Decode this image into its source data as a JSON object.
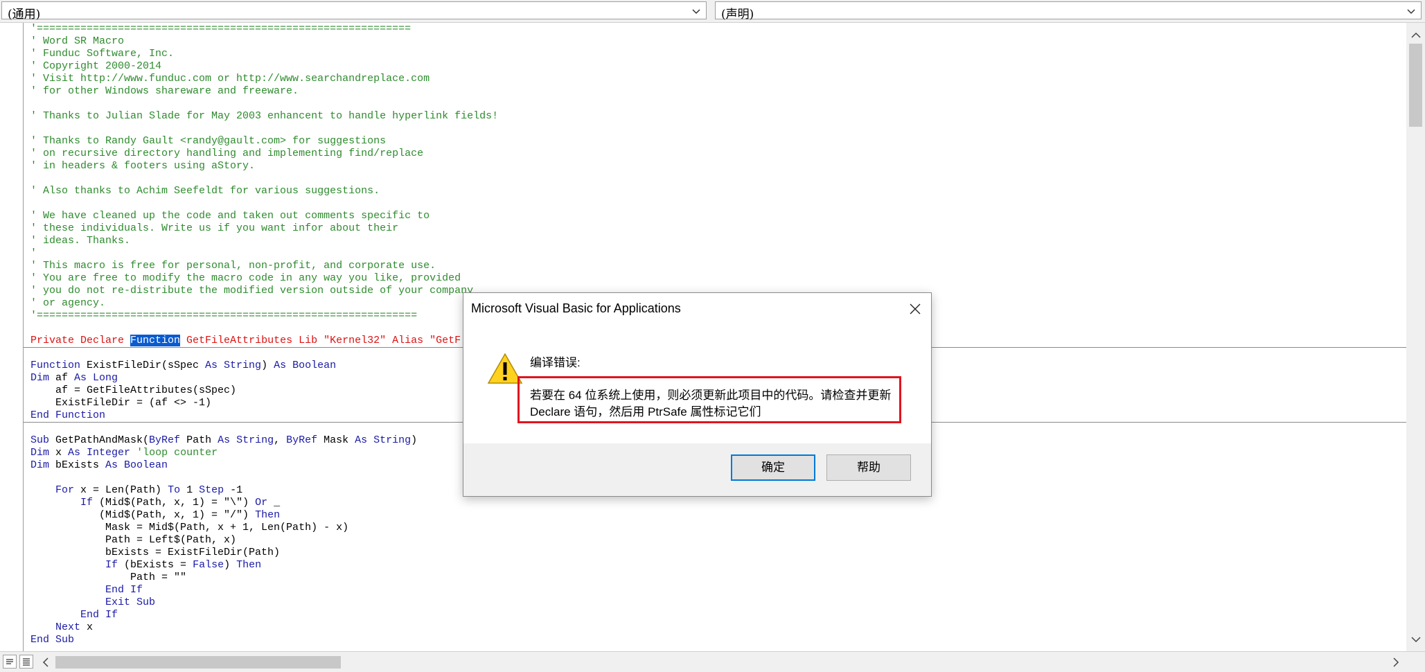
{
  "toolbar": {
    "object_combo": "(通用)",
    "procedure_combo": "(声明)"
  },
  "code_lines": [
    {
      "parts": [
        [
          "c",
          "'============================================================"
        ]
      ]
    },
    {
      "parts": [
        [
          "c",
          "' Word SR Macro"
        ]
      ]
    },
    {
      "parts": [
        [
          "c",
          "' Funduc Software, Inc."
        ]
      ]
    },
    {
      "parts": [
        [
          "c",
          "' Copyright 2000-2014"
        ]
      ]
    },
    {
      "parts": [
        [
          "c",
          "' Visit http://www.funduc.com or http://www.searchandreplace.com"
        ]
      ]
    },
    {
      "parts": [
        [
          "c",
          "' for other Windows shareware and freeware."
        ]
      ]
    },
    {
      "parts": []
    },
    {
      "parts": [
        [
          "c",
          "' Thanks to Julian Slade for May 2003 enhancent to handle hyperlink fields!"
        ]
      ]
    },
    {
      "parts": []
    },
    {
      "parts": [
        [
          "c",
          "' Thanks to Randy Gault <randy@gault.com> for suggestions"
        ]
      ]
    },
    {
      "parts": [
        [
          "c",
          "' on recursive directory handling and implementing find/replace"
        ]
      ]
    },
    {
      "parts": [
        [
          "c",
          "' in headers & footers using aStory."
        ]
      ]
    },
    {
      "parts": []
    },
    {
      "parts": [
        [
          "c",
          "' Also thanks to Achim Seefeldt for various suggestions."
        ]
      ]
    },
    {
      "parts": []
    },
    {
      "parts": [
        [
          "c",
          "' We have cleaned up the code and taken out comments specific to"
        ]
      ]
    },
    {
      "parts": [
        [
          "c",
          "' these individuals. Write us if you want infor about their"
        ]
      ]
    },
    {
      "parts": [
        [
          "c",
          "' ideas. Thanks."
        ]
      ]
    },
    {
      "parts": [
        [
          "c",
          "'"
        ]
      ]
    },
    {
      "parts": [
        [
          "c",
          "' This macro is free for personal, non-profit, and corporate use."
        ]
      ]
    },
    {
      "parts": [
        [
          "c",
          "' You are free to modify the macro code in any way you like, provided"
        ]
      ]
    },
    {
      "parts": [
        [
          "c",
          "' you do not re-distribute the modified version outside of your company"
        ]
      ]
    },
    {
      "parts": [
        [
          "c",
          "' or agency."
        ]
      ]
    },
    {
      "parts": [
        [
          "c",
          "'============================================================="
        ]
      ]
    },
    {
      "parts": []
    },
    {
      "parts": [
        [
          "e",
          "Private Declare "
        ],
        [
          "sel",
          "Function"
        ],
        [
          "e",
          " GetFileAttributes Lib \"Kernel32\" Alias \"GetF"
        ]
      ]
    },
    {
      "parts": []
    },
    {
      "parts": [
        [
          "k",
          "Function "
        ],
        [
          "t",
          "ExistFileDir(sSpec "
        ],
        [
          "k",
          "As String"
        ],
        [
          "t",
          ") "
        ],
        [
          "k",
          "As Boolean"
        ]
      ]
    },
    {
      "parts": [
        [
          "k",
          "Dim "
        ],
        [
          "t",
          "af "
        ],
        [
          "k",
          "As Long"
        ]
      ]
    },
    {
      "parts": [
        [
          "t",
          "    af = GetFileAttributes(sSpec)"
        ]
      ]
    },
    {
      "parts": [
        [
          "t",
          "    ExistFileDir = (af <> -1)"
        ]
      ]
    },
    {
      "parts": [
        [
          "k",
          "End Function"
        ]
      ]
    },
    {
      "parts": []
    },
    {
      "parts": [
        [
          "k",
          "Sub "
        ],
        [
          "t",
          "GetPathAndMask("
        ],
        [
          "k",
          "ByRef "
        ],
        [
          "t",
          "Path "
        ],
        [
          "k",
          "As String"
        ],
        [
          "t",
          ", "
        ],
        [
          "k",
          "ByRef "
        ],
        [
          "t",
          "Mask "
        ],
        [
          "k",
          "As String"
        ],
        [
          "t",
          ")"
        ]
      ]
    },
    {
      "parts": [
        [
          "k",
          "Dim "
        ],
        [
          "t",
          "x "
        ],
        [
          "k",
          "As Integer "
        ],
        [
          "c",
          "'loop counter"
        ]
      ]
    },
    {
      "parts": [
        [
          "k",
          "Dim "
        ],
        [
          "t",
          "bExists "
        ],
        [
          "k",
          "As Boolean"
        ]
      ]
    },
    {
      "parts": []
    },
    {
      "parts": [
        [
          "t",
          "    "
        ],
        [
          "k",
          "For "
        ],
        [
          "t",
          "x = Len(Path) "
        ],
        [
          "k",
          "To "
        ],
        [
          "t",
          "1 "
        ],
        [
          "k",
          "Step "
        ],
        [
          "t",
          "-1"
        ]
      ]
    },
    {
      "parts": [
        [
          "t",
          "        "
        ],
        [
          "k",
          "If "
        ],
        [
          "t",
          "(Mid$(Path, x, 1) = \"\\\") "
        ],
        [
          "k",
          "Or "
        ],
        [
          "t",
          "_"
        ]
      ]
    },
    {
      "parts": [
        [
          "t",
          "           (Mid$(Path, x, 1) = \"/\") "
        ],
        [
          "k",
          "Then"
        ]
      ]
    },
    {
      "parts": [
        [
          "t",
          "            Mask = Mid$(Path, x + 1, Len(Path) - x)"
        ]
      ]
    },
    {
      "parts": [
        [
          "t",
          "            Path = Left$(Path, x)"
        ]
      ]
    },
    {
      "parts": [
        [
          "t",
          "            bExists = ExistFileDir(Path)"
        ]
      ]
    },
    {
      "parts": [
        [
          "t",
          "            "
        ],
        [
          "k",
          "If "
        ],
        [
          "t",
          "(bExists = "
        ],
        [
          "k",
          "False"
        ],
        [
          "t",
          ") "
        ],
        [
          "k",
          "Then"
        ]
      ]
    },
    {
      "parts": [
        [
          "t",
          "                Path = \"\""
        ]
      ]
    },
    {
      "parts": [
        [
          "t",
          "            "
        ],
        [
          "k",
          "End If"
        ]
      ]
    },
    {
      "parts": [
        [
          "t",
          "            "
        ],
        [
          "k",
          "Exit Sub"
        ]
      ]
    },
    {
      "parts": [
        [
          "t",
          "        "
        ],
        [
          "k",
          "End If"
        ]
      ]
    },
    {
      "parts": [
        [
          "t",
          "    "
        ],
        [
          "k",
          "Next "
        ],
        [
          "t",
          "x"
        ]
      ]
    },
    {
      "parts": [
        [
          "k",
          "End Sub"
        ]
      ]
    }
  ],
  "dialog": {
    "title": "Microsoft Visual Basic for Applications",
    "heading": "编译错误:",
    "message_line1": "若要在 64 位系统上使用，则必须更新此项目中的代码。请检查并更新",
    "message_line2": "Declare 语句，然后用 PtrSafe 属性标记它们",
    "ok_label": "确定",
    "help_label": "帮助"
  },
  "colors": {
    "comment": "#2e8b2e",
    "keyword": "#1a1aa6",
    "error": "#dd1111",
    "selection": "#0a5bd0",
    "highlight_border": "#e0141e"
  }
}
